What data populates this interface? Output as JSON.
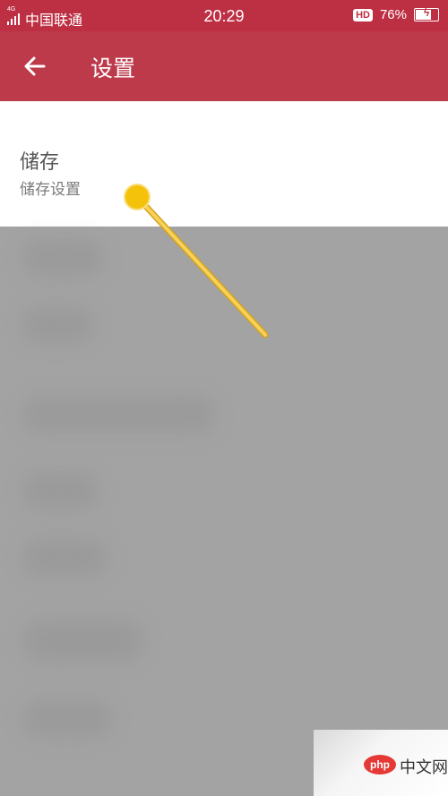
{
  "status_bar": {
    "network_type": "4G",
    "carrier": "中国联通",
    "time": "20:29",
    "hd_badge": "HD",
    "battery_percent": "76%",
    "battery_level": 0.76
  },
  "app_bar": {
    "title": "设置",
    "background_color": "#bd3a4b"
  },
  "storage_item": {
    "title": "储存",
    "subtitle": "储存设置"
  },
  "watermark": {
    "logo_text": "php",
    "site_text": "中文网"
  }
}
